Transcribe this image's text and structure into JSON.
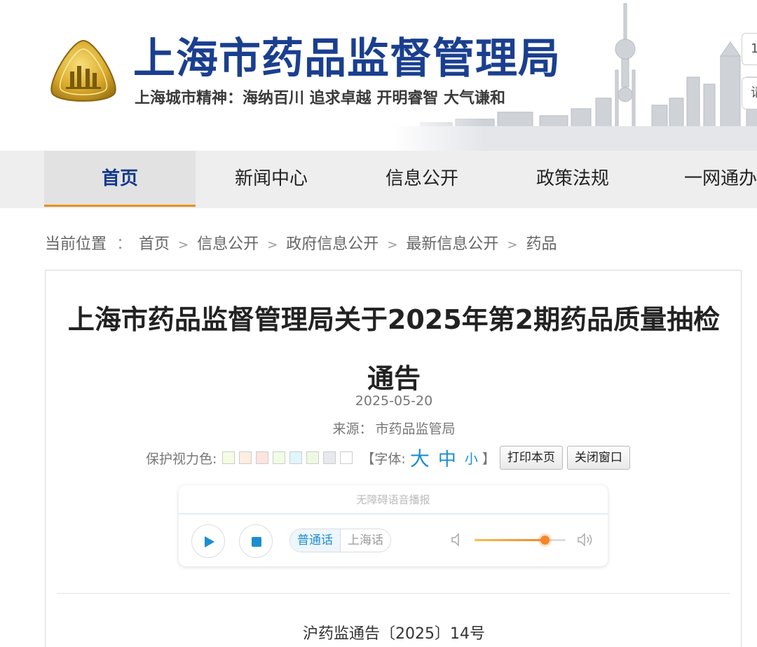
{
  "header": {
    "title": "上海市药品监督管理局",
    "slogan": "上海城市精神：海纳百川  追求卓越  开明睿智  大气谦和",
    "logo_icon": "shanghai-emblem-icon",
    "right_button_1": "1",
    "right_button_2": "请"
  },
  "nav": {
    "items": [
      {
        "label": "首页",
        "active": true
      },
      {
        "label": "新闻中心",
        "active": false
      },
      {
        "label": "信息公开",
        "active": false
      },
      {
        "label": "政策法规",
        "active": false
      },
      {
        "label": "一网通办",
        "active": false
      }
    ],
    "active_color": "#12398a",
    "underline_color": "#e8901a"
  },
  "breadcrumb": {
    "prefix": "当前位置",
    "colon": "：",
    "separator": ">",
    "items": [
      "首页",
      "信息公开",
      "政府信息公开",
      "最新信息公开",
      "药品"
    ]
  },
  "article": {
    "title": "上海市药品监督管理局关于2025年第2期药品质量抽检通告",
    "date": "2025-05-20",
    "source_label": "来源：",
    "source": "市药品监管局",
    "eye_color_label": "保护视力色:",
    "swatch_colors": [
      "#f6fbe3",
      "#fdeee0",
      "#fde4df",
      "#f0fce4",
      "#dff6fb",
      "#eef9e2",
      "#e8e9ef",
      "#ffffff"
    ],
    "font_label_open": "【字体:",
    "font_sizes": [
      "大",
      "中",
      "小"
    ],
    "font_label_close": "】",
    "print_button": "打印本页",
    "close_button": "关闭窗口",
    "doc_number": "沪药监通告〔2025〕14号"
  },
  "player": {
    "title": "无障碍语音播报",
    "dialects": [
      "普通话",
      "上海话"
    ],
    "selected_dialect": "普通话",
    "volume": 0.77,
    "accent_color": "#1b8ed1",
    "volume_color": "#f5862a"
  }
}
